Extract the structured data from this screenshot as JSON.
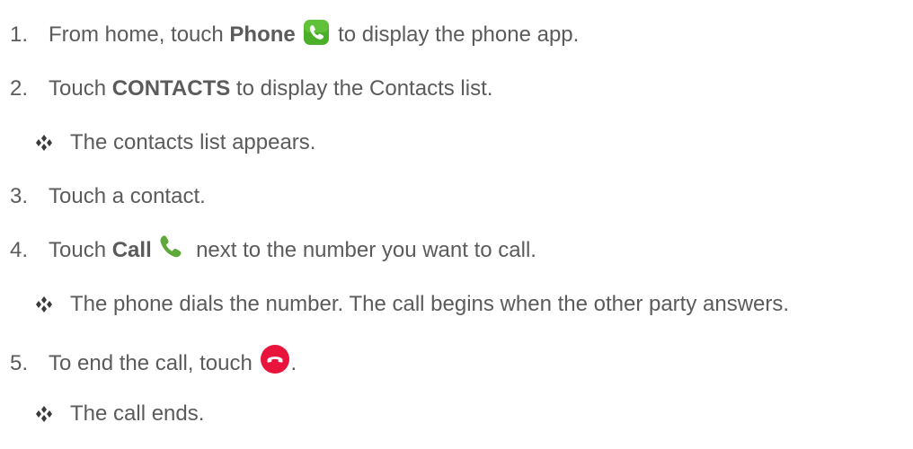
{
  "steps": [
    {
      "num": "1.",
      "pre": "From home, touch ",
      "bold": "Phone",
      "post": " to display the phone app.",
      "icon": "phone-app-icon"
    },
    {
      "num": "2.",
      "pre": "Touch ",
      "bold": "CONTACTS",
      "post": " to display the Contacts list."
    },
    {
      "num": "3.",
      "pre": "Touch a contact."
    },
    {
      "num": "4.",
      "pre": "Touch ",
      "bold": "Call",
      "post": " next to the number you want to call.",
      "icon": "call-icon"
    },
    {
      "num": "5.",
      "pre": "To end the call, touch ",
      "post": ".",
      "icon": "end-call-icon"
    }
  ],
  "results": [
    "The contacts list appears.",
    "The phone dials the number. The call begins when the other party answers.",
    "The call ends."
  ],
  "colors": {
    "text": "#5b5b5b",
    "phone_app_green": "#4caf2a",
    "call_green": "#5fa83a",
    "end_call_red": "#e8143c",
    "bullet": "#3a3a3a"
  }
}
